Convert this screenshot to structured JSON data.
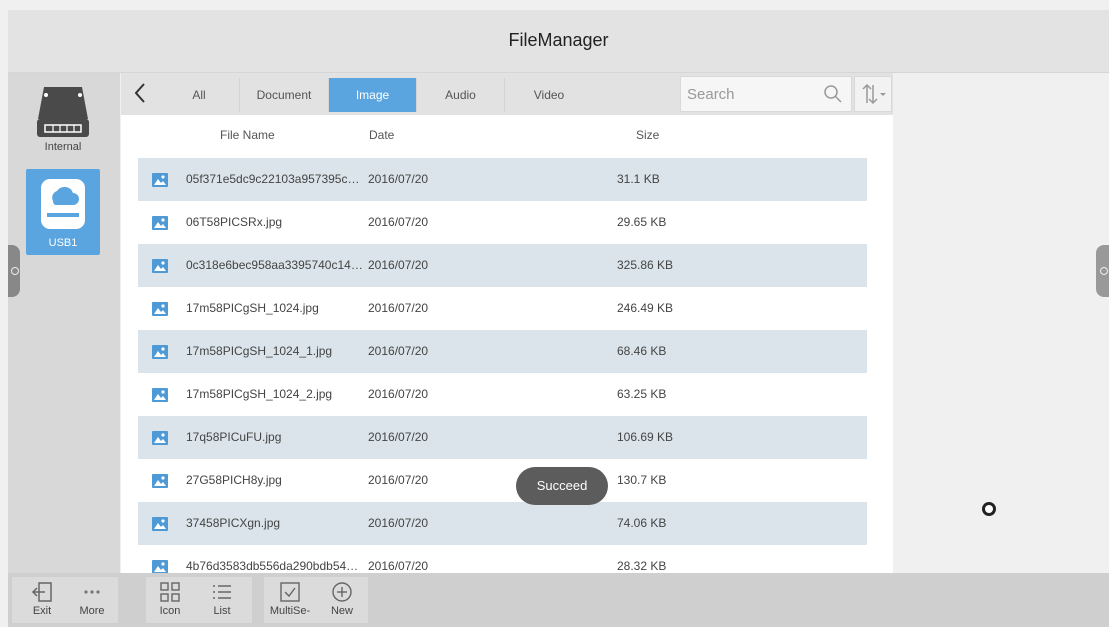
{
  "app": {
    "title": "FileManager"
  },
  "sidebar": {
    "drives": [
      {
        "label": "Internal",
        "icon": "hard-drive-icon",
        "selected": false
      },
      {
        "label": "USB1",
        "icon": "usb-drive-icon",
        "selected": true
      }
    ]
  },
  "tabs": [
    {
      "label": "All",
      "active": false
    },
    {
      "label": "Document",
      "active": false
    },
    {
      "label": "Image",
      "active": true
    },
    {
      "label": "Audio",
      "active": false
    },
    {
      "label": "Video",
      "active": false
    }
  ],
  "search": {
    "placeholder": "Search"
  },
  "columns": {
    "name": "File Name",
    "date": "Date",
    "size": "Size"
  },
  "files": [
    {
      "name": "05f371e5dc9c22103a957395c…",
      "date": "2016/07/20",
      "size": "31.1 KB"
    },
    {
      "name": "06T58PICSRx.jpg",
      "date": "2016/07/20",
      "size": "29.65 KB"
    },
    {
      "name": "0c318e6bec958aa3395740c14…",
      "date": "2016/07/20",
      "size": "325.86 KB"
    },
    {
      "name": "17m58PICgSH_1024.jpg",
      "date": "2016/07/20",
      "size": "246.49 KB"
    },
    {
      "name": "17m58PICgSH_1024_1.jpg",
      "date": "2016/07/20",
      "size": "68.46 KB"
    },
    {
      "name": "17m58PICgSH_1024_2.jpg",
      "date": "2016/07/20",
      "size": "63.25 KB"
    },
    {
      "name": "17q58PICuFU.jpg",
      "date": "2016/07/20",
      "size": "106.69 KB"
    },
    {
      "name": "27G58PICH8y.jpg",
      "date": "2016/07/20",
      "size": "130.7 KB"
    },
    {
      "name": "37458PICXgn.jpg",
      "date": "2016/07/20",
      "size": "74.06 KB"
    },
    {
      "name": "4b76d3583db556da290bdb54…",
      "date": "2016/07/20",
      "size": "28.32 KB"
    }
  ],
  "toast": {
    "text": "Succeed"
  },
  "toolbar": {
    "exit": "Exit",
    "more": "More",
    "icon": "Icon",
    "list": "List",
    "multiselect": "MultiSe-",
    "new": "New"
  },
  "colors": {
    "accent": "#5aa5e0",
    "row_alt": "#dae4ea",
    "toast_bg": "#5c5c5c"
  }
}
